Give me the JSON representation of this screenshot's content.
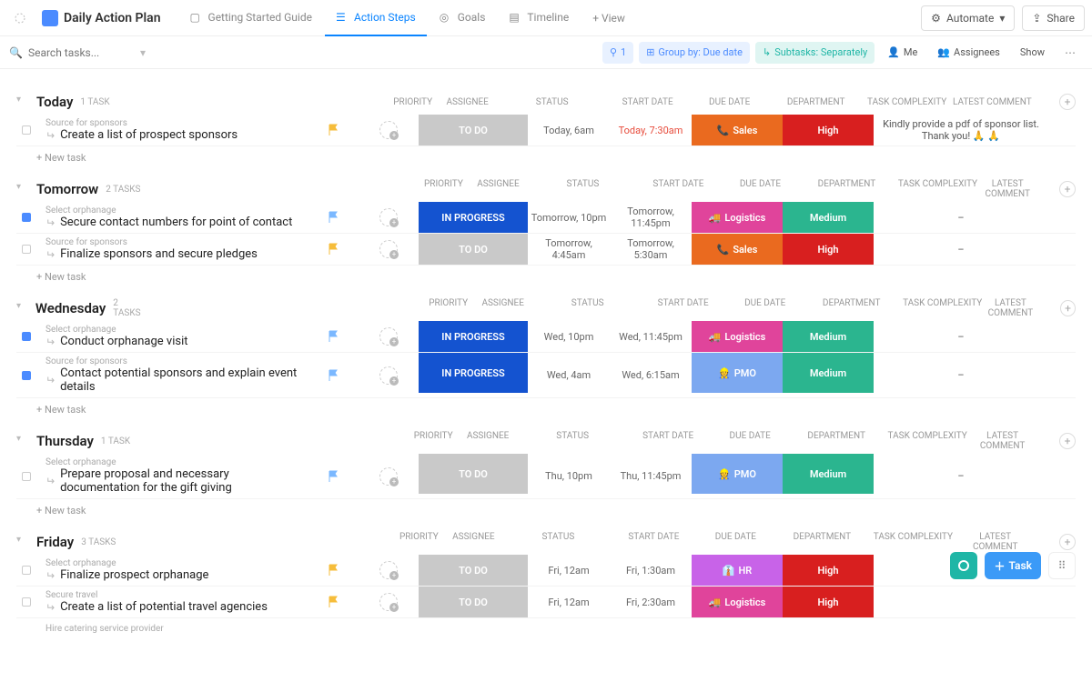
{
  "header": {
    "title": "Daily Action Plan",
    "tabs": [
      "Getting Started Guide",
      "Action Steps",
      "Goals",
      "Timeline"
    ],
    "addView": "+ View",
    "automate": "Automate",
    "share": "Share"
  },
  "filters": {
    "searchPlaceholder": "Search tasks...",
    "filterCount": "1",
    "groupBy": "Group by: Due date",
    "subtasks": "Subtasks: Separately",
    "me": "Me",
    "assignees": "Assignees",
    "show": "Show"
  },
  "cols": {
    "priority": "PRIORITY",
    "assignee": "ASSIGNEE",
    "status": "STATUS",
    "start": "START DATE",
    "due": "DUE DATE",
    "dept": "DEPARTMENT",
    "cmpx": "TASK COMPLEXITY",
    "cmt": "LATEST COMMENT"
  },
  "status": {
    "todo": "TO DO",
    "prog": "IN PROGRESS"
  },
  "dept": {
    "sales": "Sales",
    "log": "Logistics",
    "pmo": "PMO",
    "hr": "HR"
  },
  "cmpx": {
    "high": "High",
    "med": "Medium"
  },
  "newtask": "+ New task",
  "groups": [
    {
      "name": "Today",
      "count": "1 TASK",
      "rows": [
        {
          "parent": "Source for sponsors",
          "name": "Create a list of prospect sponsors",
          "flag": "yellow",
          "status": "todo",
          "sd": "Today, 6am",
          "dd": "Today, 7:30am",
          "ddRed": true,
          "dept": "sales",
          "cmpx": "high",
          "cmt": "Kindly provide a pdf of sponsor list. Thank you! 🙏 🙏",
          "chk": "grey"
        }
      ]
    },
    {
      "name": "Tomorrow",
      "count": "2 TASKS",
      "rows": [
        {
          "parent": "Select orphanage",
          "name": "Secure contact numbers for point of contact",
          "flag": "blue",
          "status": "prog",
          "sd": "Tomorrow, 10pm",
          "dd": "Tomorrow, 11:45pm",
          "dept": "log",
          "cmpx": "med",
          "cmt": "–",
          "chk": "blue"
        },
        {
          "parent": "Source for sponsors",
          "name": "Finalize sponsors and secure pledges",
          "flag": "yellow",
          "status": "todo",
          "sd": "Tomorrow, 4:45am",
          "dd": "Tomorrow, 5:30am",
          "dept": "sales",
          "cmpx": "high",
          "cmt": "–",
          "chk": "grey"
        }
      ]
    },
    {
      "name": "Wednesday",
      "count": "2 TASKS",
      "rows": [
        {
          "parent": "Select orphanage",
          "name": "Conduct orphanage visit",
          "flag": "blue",
          "status": "prog",
          "sd": "Wed, 10pm",
          "dd": "Wed, 11:45pm",
          "dept": "log",
          "cmpx": "med",
          "cmt": "–",
          "chk": "blue"
        },
        {
          "parent": "Source for sponsors",
          "name": "Contact potential sponsors and explain event details",
          "flag": "blue",
          "status": "prog",
          "sd": "Wed, 4am",
          "dd": "Wed, 6:15am",
          "dept": "pmo",
          "cmpx": "med",
          "cmt": "–",
          "chk": "blue",
          "tall": true
        }
      ]
    },
    {
      "name": "Thursday",
      "count": "1 TASK",
      "rows": [
        {
          "parent": "Select orphanage",
          "name": "Prepare proposal and necessary documentation for the gift giving",
          "flag": "blue",
          "status": "todo",
          "sd": "Thu, 10pm",
          "dd": "Thu, 11:45pm",
          "dept": "pmo",
          "cmpx": "med",
          "cmt": "–",
          "chk": "grey",
          "tall": true
        }
      ]
    },
    {
      "name": "Friday",
      "count": "3 TASKS",
      "rows": [
        {
          "parent": "Select orphanage",
          "name": "Finalize prospect orphanage",
          "flag": "yellow",
          "status": "todo",
          "sd": "Fri, 12am",
          "dd": "Fri, 1:30am",
          "dept": "hr",
          "cmpx": "high",
          "cmt": "",
          "chk": "grey"
        },
        {
          "parent": "Secure travel",
          "name": "Create a list of potential travel agencies",
          "flag": "yellow",
          "status": "todo",
          "sd": "Fri, 12am",
          "dd": "Fri, 2:30am",
          "dept": "log",
          "cmpx": "high",
          "cmt": "",
          "chk": "grey"
        }
      ],
      "trailing": "Hire catering service provider"
    }
  ],
  "float": {
    "task": "Task"
  }
}
